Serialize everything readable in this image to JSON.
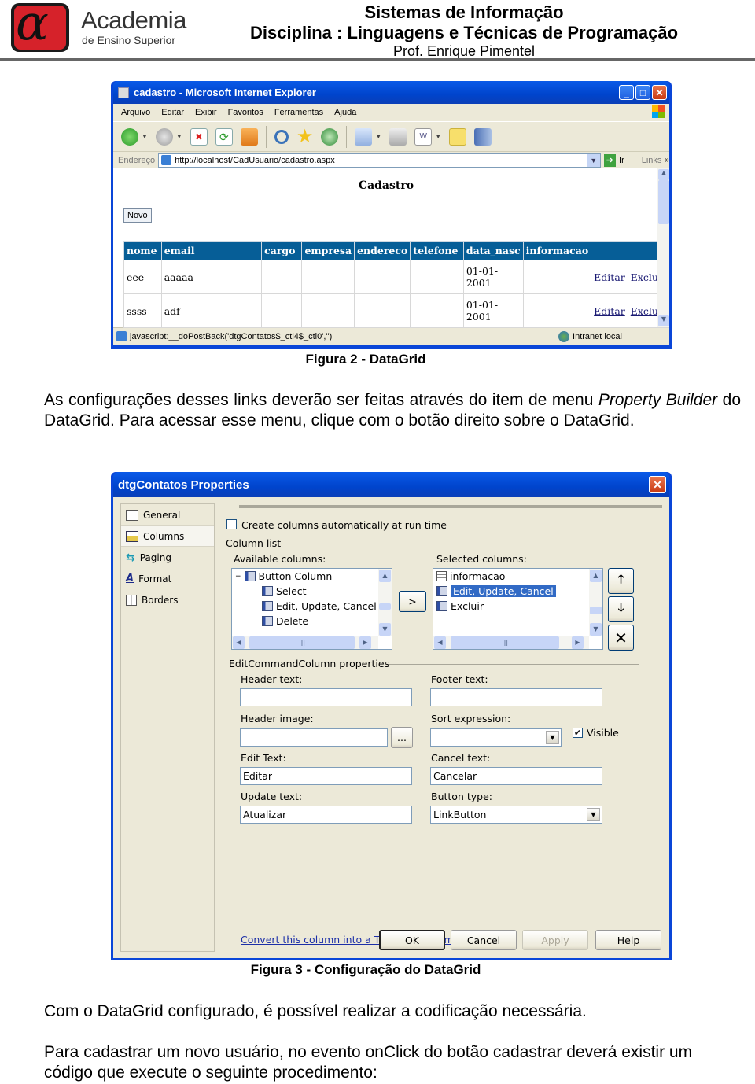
{
  "header": {
    "logo_name": "Academia",
    "logo_sub": "de Ensino Superior",
    "line1": "Sistemas de Informação",
    "line2": "Disciplina : Linguagens e Técnicas de Programação",
    "line3": "Prof. Enrique Pimentel"
  },
  "browser": {
    "title": "cadastro - Microsoft Internet Explorer",
    "menu": [
      "Arquivo",
      "Editar",
      "Exibir",
      "Favoritos",
      "Ferramentas",
      "Ajuda"
    ],
    "toolbar_icons": [
      "back-icon",
      "forward-icon",
      "stop-icon",
      "refresh-icon",
      "home-icon",
      "search-icon",
      "favorites-icon",
      "history-icon",
      "mail-icon",
      "print-icon",
      "edit-word-icon",
      "notes-icon",
      "research-icon"
    ],
    "address_label": "Endereço",
    "address_url": "http://localhost/CadUsuario/cadastro.aspx",
    "go_label": "Ir",
    "links_label": "Links",
    "page": {
      "heading": "Cadastro",
      "new_button": "Novo",
      "columns": [
        "nome",
        "email",
        "cargo",
        "empresa",
        "endereco",
        "telefone",
        "data_nasc",
        "informacao",
        "",
        ""
      ],
      "rows": [
        {
          "nome": "eee",
          "email": "aaaaa",
          "cargo": "",
          "empresa": "",
          "endereco": "",
          "telefone": "",
          "data_nasc": "01-01-2001",
          "informacao": "",
          "edit": "Editar",
          "delete": "Excluir"
        },
        {
          "nome": "ssss",
          "email": "adf",
          "cargo": "",
          "empresa": "",
          "endereco": "",
          "telefone": "",
          "data_nasc": "01-01-2001",
          "informacao": "",
          "edit": "Editar",
          "delete": "Excluir"
        }
      ]
    },
    "status_text": "javascript:__doPostBack('dtgContatos$_ctl4$_ctl0','')",
    "zone": "Intranet local"
  },
  "caption2": "Figura 2 - DataGrid",
  "paragraph1": {
    "before": "As configurações desses links deverão ser feitas através do item de menu ",
    "italic": "Property Builder",
    "after": " do DataGrid. Para acessar esse menu, clique com o botão direito sobre o DataGrid."
  },
  "dialog": {
    "title": "dtgContatos Properties",
    "nav": [
      {
        "label": "General",
        "icon": "general-icon"
      },
      {
        "label": "Columns",
        "icon": "columns-icon",
        "selected": true
      },
      {
        "label": "Paging",
        "icon": "paging-icon"
      },
      {
        "label": "Format",
        "icon": "format-icon"
      },
      {
        "label": "Borders",
        "icon": "borders-icon"
      }
    ],
    "auto_columns_label": "Create columns automatically at run time",
    "auto_columns_checked": false,
    "column_list_label": "Column list",
    "available_label": "Available columns:",
    "available": [
      {
        "label": "Button Column",
        "level": 0
      },
      {
        "label": "Select",
        "level": 1
      },
      {
        "label": "Edit, Update, Cancel",
        "level": 1
      },
      {
        "label": "Delete",
        "level": 1
      }
    ],
    "add_button": ">",
    "selected_label": "Selected columns:",
    "selected": [
      {
        "label": "informacao",
        "type": "bound"
      },
      {
        "label": "Edit, Update, Cancel",
        "type": "button",
        "selected": true
      },
      {
        "label": "Excluir",
        "type": "button"
      }
    ],
    "properties_group": "EditCommandColumn properties",
    "header_text_label": "Header text:",
    "header_text": "",
    "footer_text_label": "Footer text:",
    "footer_text": "",
    "header_image_label": "Header image:",
    "header_image": "",
    "browse_button": "...",
    "sort_expression_label": "Sort expression:",
    "sort_expression": "",
    "visible_label": "Visible",
    "visible_checked": true,
    "edit_text_label": "Edit Text:",
    "edit_text": "Editar",
    "cancel_text_label": "Cancel text:",
    "cancel_text": "Cancelar",
    "update_text_label": "Update text:",
    "update_text": "Atualizar",
    "button_type_label": "Button type:",
    "button_type": "LinkButton",
    "convert_link": "Convert this column into a Template Column",
    "buttons": {
      "ok": "OK",
      "cancel": "Cancel",
      "apply": "Apply",
      "help": "Help"
    }
  },
  "caption3": "Figura 3 - Configuração do DataGrid",
  "paragraph2": "Com o DataGrid configurado, é possível realizar a codificação necessária.",
  "paragraph3": "Para cadastrar um novo usuário, no evento onClick do botão cadastrar deverá existir um código que execute o seguinte procedimento:"
}
